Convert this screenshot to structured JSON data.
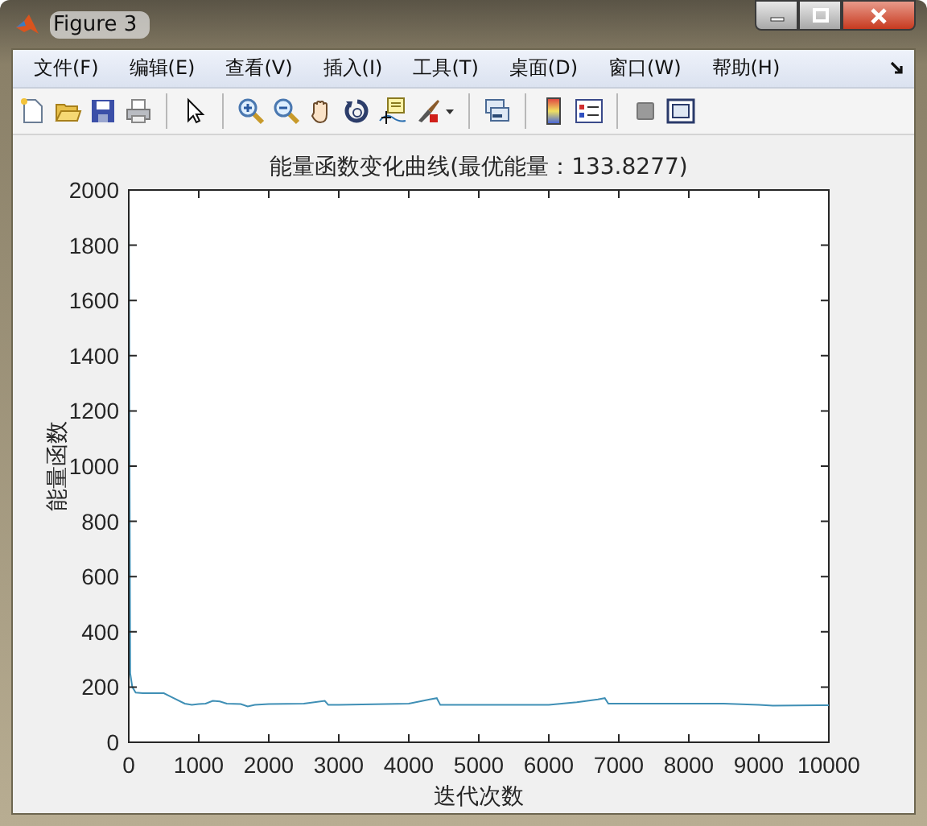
{
  "window": {
    "title": "Figure 3"
  },
  "menu": [
    {
      "label": "文件(F)"
    },
    {
      "label": "编辑(E)"
    },
    {
      "label": "查看(V)"
    },
    {
      "label": "插入(I)"
    },
    {
      "label": "工具(T)"
    },
    {
      "label": "桌面(D)"
    },
    {
      "label": "窗口(W)"
    },
    {
      "label": "帮助(H)"
    }
  ],
  "chart_data": {
    "type": "line",
    "title": "能量函数变化曲线(最优能量：133.8277)",
    "xlabel": "迭代次数",
    "ylabel": "能量函数",
    "xlim": [
      0,
      10000
    ],
    "ylim": [
      0,
      2000
    ],
    "xticks": [
      0,
      1000,
      2000,
      3000,
      4000,
      5000,
      6000,
      7000,
      8000,
      9000,
      10000
    ],
    "yticks": [
      0,
      200,
      400,
      600,
      800,
      1000,
      1200,
      1400,
      1600,
      1800,
      2000
    ],
    "x": [
      0,
      20,
      50,
      100,
      200,
      500,
      600,
      800,
      900,
      1000,
      1100,
      1200,
      1300,
      1400,
      1600,
      1700,
      1800,
      2000,
      2500,
      2800,
      2850,
      3000,
      4000,
      4300,
      4400,
      4450,
      5000,
      6000,
      6400,
      6700,
      6800,
      6850,
      7000,
      8000,
      8500,
      9000,
      9200,
      10000
    ],
    "series": [
      {
        "color": "#3f8fb5",
        "values": [
          2000,
          250,
          200,
          180,
          178,
          178,
          165,
          140,
          135,
          138,
          140,
          150,
          148,
          140,
          138,
          130,
          135,
          138,
          140,
          150,
          135,
          135,
          140,
          155,
          160,
          135,
          135,
          135,
          145,
          155,
          160,
          140,
          140,
          140,
          140,
          135,
          133,
          134
        ]
      }
    ]
  }
}
